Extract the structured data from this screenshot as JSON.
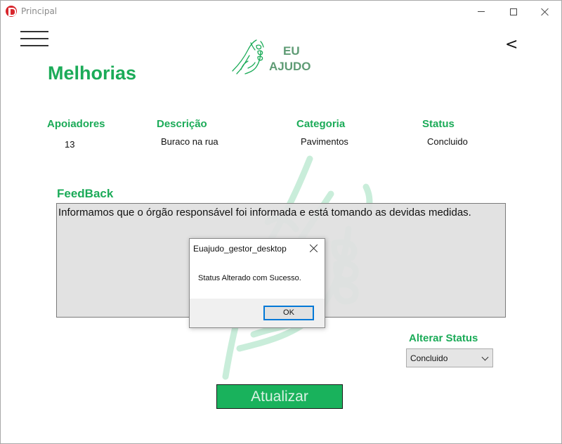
{
  "window": {
    "title": "Principal",
    "controls": [
      "minimize-icon",
      "maximize-icon",
      "close-icon"
    ]
  },
  "header": {
    "logo_line1": "EU",
    "logo_line2": "AJUDO",
    "back_symbol": "<",
    "menu_icon": "hamburger-icon"
  },
  "page": {
    "title": "Melhorias"
  },
  "info": {
    "columns": [
      {
        "label": "Apoiadores",
        "value": "13"
      },
      {
        "label": "Descrição",
        "value": "Buraco na rua"
      },
      {
        "label": "Categoria",
        "value": "Pavimentos"
      },
      {
        "label": "Status",
        "value": "Concluido"
      }
    ]
  },
  "feedback": {
    "label": "FeedBack",
    "text": "Informamos que o órgão responsável foi informada e está tomando as devidas medidas."
  },
  "status_control": {
    "label": "Alterar Status",
    "selected": "Concluido"
  },
  "actions": {
    "update_label": "Atualizar"
  },
  "dialog": {
    "title": "Euajudo_gestor_desktop",
    "message": "Status Alterado com Sucesso.",
    "ok_label": "OK"
  },
  "colors": {
    "accent": "#1bab58",
    "button": "#19b25c",
    "logo": "#5e9b74",
    "app_icon": "#d8262d",
    "focus": "#0078d7"
  }
}
